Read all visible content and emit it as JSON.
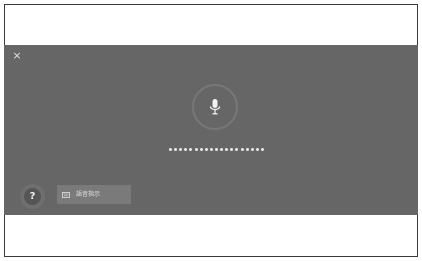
{
  "dialog": {
    "close_icon": "close-icon",
    "close_symbol": "×",
    "mic_icon": "microphone-icon",
    "listening_dots_count": 19,
    "help_icon": "question-icon",
    "help_symbol": "?",
    "action": {
      "icon": "keyboard-icon",
      "label": "語音指示"
    }
  },
  "colors": {
    "overlay": "#666666",
    "accent_light": "#e6e6e6"
  }
}
